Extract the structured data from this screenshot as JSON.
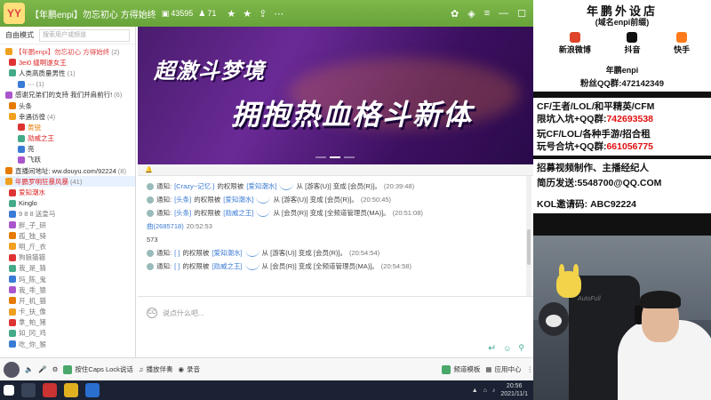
{
  "titlebar": {
    "logo_text": "YY",
    "title": "【年鹏enpi】勿忘初心 方得始终",
    "viewers": "43595",
    "users": "71",
    "colors": {
      "bg": "#6ca83d"
    }
  },
  "left": {
    "mode": "自由模式",
    "search_placeholder": "搜索用户或频道",
    "rows": [
      {
        "text": "【年鹏enpi】勿忘初心 方得始终",
        "count": "(2)",
        "cls": "",
        "color": "#e04040"
      },
      {
        "text": "3ei0  缝啊遂女王",
        "count": "",
        "cls": "ch",
        "color": "#d22"
      },
      {
        "text": "人类高质量男性",
        "count": "(1)",
        "cls": "ch",
        "color": "#333"
      },
      {
        "text": "··· ",
        "count": "(1)",
        "cls": "ch2",
        "color": "#333"
      },
      {
        "text": "感谢兄弟们的支持  我们并肩前行!",
        "count": "(6)",
        "cls": "",
        "color": "#333"
      },
      {
        "text": "头条",
        "count": "",
        "cls": "ch",
        "color": "#333"
      },
      {
        "text": "幸遇彷徨",
        "count": "(4)",
        "cls": "ch",
        "color": "#333"
      },
      {
        "text": "黄锐",
        "count": "",
        "cls": "ch2",
        "color": "#e67a00"
      },
      {
        "text": "勋威之王",
        "count": "",
        "cls": "ch2",
        "color": "#d22"
      },
      {
        "text": "亮",
        "count": "",
        "cls": "ch2",
        "color": "#333"
      },
      {
        "text": "飞跃",
        "count": "",
        "cls": "ch2",
        "color": "#333"
      },
      {
        "text": "直播间地址: ww.douyu.com/92224",
        "count": "(8)",
        "cls": "",
        "color": "#333"
      },
      {
        "text": "年鹏罗明狂暴风暴",
        "count": "(41)",
        "cls": "sel",
        "color": "#d22"
      },
      {
        "text": "爱知潮水",
        "count": "",
        "cls": "ch",
        "color": "#d22"
      },
      {
        "text": "Kinglo",
        "count": "",
        "cls": "ch",
        "color": "#333"
      },
      {
        "text": "9 8 8 送皇马",
        "count": "",
        "cls": "ch",
        "color": "#777"
      },
      {
        "text": "胖_子_研",
        "count": "",
        "cls": "ch",
        "color": "#777"
      },
      {
        "text": "孤_独_骑",
        "count": "",
        "cls": "ch",
        "color": "#777"
      },
      {
        "text": "明_斤_衣",
        "count": "",
        "cls": "ch",
        "color": "#777"
      },
      {
        "text": "狗狼猫猫",
        "count": "",
        "cls": "ch",
        "color": "#777"
      },
      {
        "text": "我_是_猜",
        "count": "",
        "cls": "ch",
        "color": "#777"
      },
      {
        "text": "玛_陈_鬼",
        "count": "",
        "cls": "ch",
        "color": "#777"
      },
      {
        "text": "我_乖_猿",
        "count": "",
        "cls": "ch",
        "color": "#777"
      },
      {
        "text": "开_机_猫",
        "count": "",
        "cls": "ch",
        "color": "#777"
      },
      {
        "text": "卡_扶_像",
        "count": "",
        "cls": "ch",
        "color": "#777"
      },
      {
        "text": "拿_帕_猪",
        "count": "",
        "cls": "ch",
        "color": "#777"
      },
      {
        "text": "如_冈_鸡",
        "count": "",
        "cls": "ch",
        "color": "#777"
      },
      {
        "text": "吃_你_猴",
        "count": "",
        "cls": "ch",
        "color": "#777"
      }
    ]
  },
  "banner": {
    "line1": "超激斗梦境",
    "line2": "拥抱热血格斗新体"
  },
  "chat": {
    "messages": [
      {
        "prefix": "通知:",
        "user": "[Crazy~记忆.]",
        "action": "的权限被",
        "target": "[爱知潮水]",
        "mid": "从 [游客(U)] 变成 [会员(R)]。",
        "time": "(20:39:48)"
      },
      {
        "prefix": "通知:",
        "user": "[头条]",
        "action": "的权限被",
        "target": "[爱知潮水]",
        "mid": "从 [游客(U)] 变成 [会员(R)]。",
        "time": "(20:50:45)"
      },
      {
        "prefix": "通知:",
        "user": "[头条]",
        "action": "的权限被",
        "target": "[勋威之王]",
        "mid": "从 [会员(R)] 变成 [全频道管理员(MA)]。",
        "time": "(20:51:08)"
      },
      {
        "prefix": "",
        "user": "曲(2685718)",
        "action": "",
        "target": "",
        "mid": "",
        "time": "20:52:53"
      },
      {
        "prefix": "",
        "user": "",
        "action": "573",
        "target": "",
        "mid": "",
        "time": ""
      },
      {
        "prefix": "通知:",
        "user": "[  ]",
        "action": "的权限被",
        "target": "[爱知潮水]",
        "mid": "从 [游客(U)] 变成 [会员(R)]。",
        "time": "(20:54:54)"
      },
      {
        "prefix": "通知:",
        "user": "[  ]",
        "action": "的权限被",
        "target": "[勋威之王]",
        "mid": "从 [会员(R)] 变成 [全频道管理员(MA)]。",
        "time": "(20:54:58)"
      }
    ],
    "input_placeholder": "说点什么吧...",
    "send_tools": [
      "↵",
      "☺",
      "⚲"
    ]
  },
  "bottom": {
    "caps_label": "按住Caps Lock说话",
    "music_label": "播放伴奏",
    "record_label": "录音",
    "channel_template": "频道模板",
    "app_center": "应用中心"
  },
  "taskbar": {
    "time": "20:56",
    "date": "2021/11/1"
  },
  "overlay": {
    "title": "年鹏外设店",
    "subtitle": "(域名enpi前缀)",
    "socials": [
      {
        "label": "新浪微博",
        "color": "#e0442a"
      },
      {
        "label": "抖音",
        "color": "#111111"
      },
      {
        "label": "快手",
        "color": "#ff7a1a"
      }
    ],
    "name": "年鹏enpi",
    "fans_label": "粉丝QQ群:",
    "fans_qq": "472142349",
    "line1": "CF/王者/LOL/和平精英/CFM",
    "line2_a": "限坑入坑+QQ群:",
    "line2_b": "742693538",
    "line3": "玩CF/LOL/各种手游/招合租",
    "line4_a": "玩号合坑+QQ群:",
    "line4_b": "661056775",
    "line5": "招募视频制作、主播经纪人",
    "line6": "简历发送:5548700@QQ.COM",
    "line7": "KOL邀请码: ABC92224"
  }
}
